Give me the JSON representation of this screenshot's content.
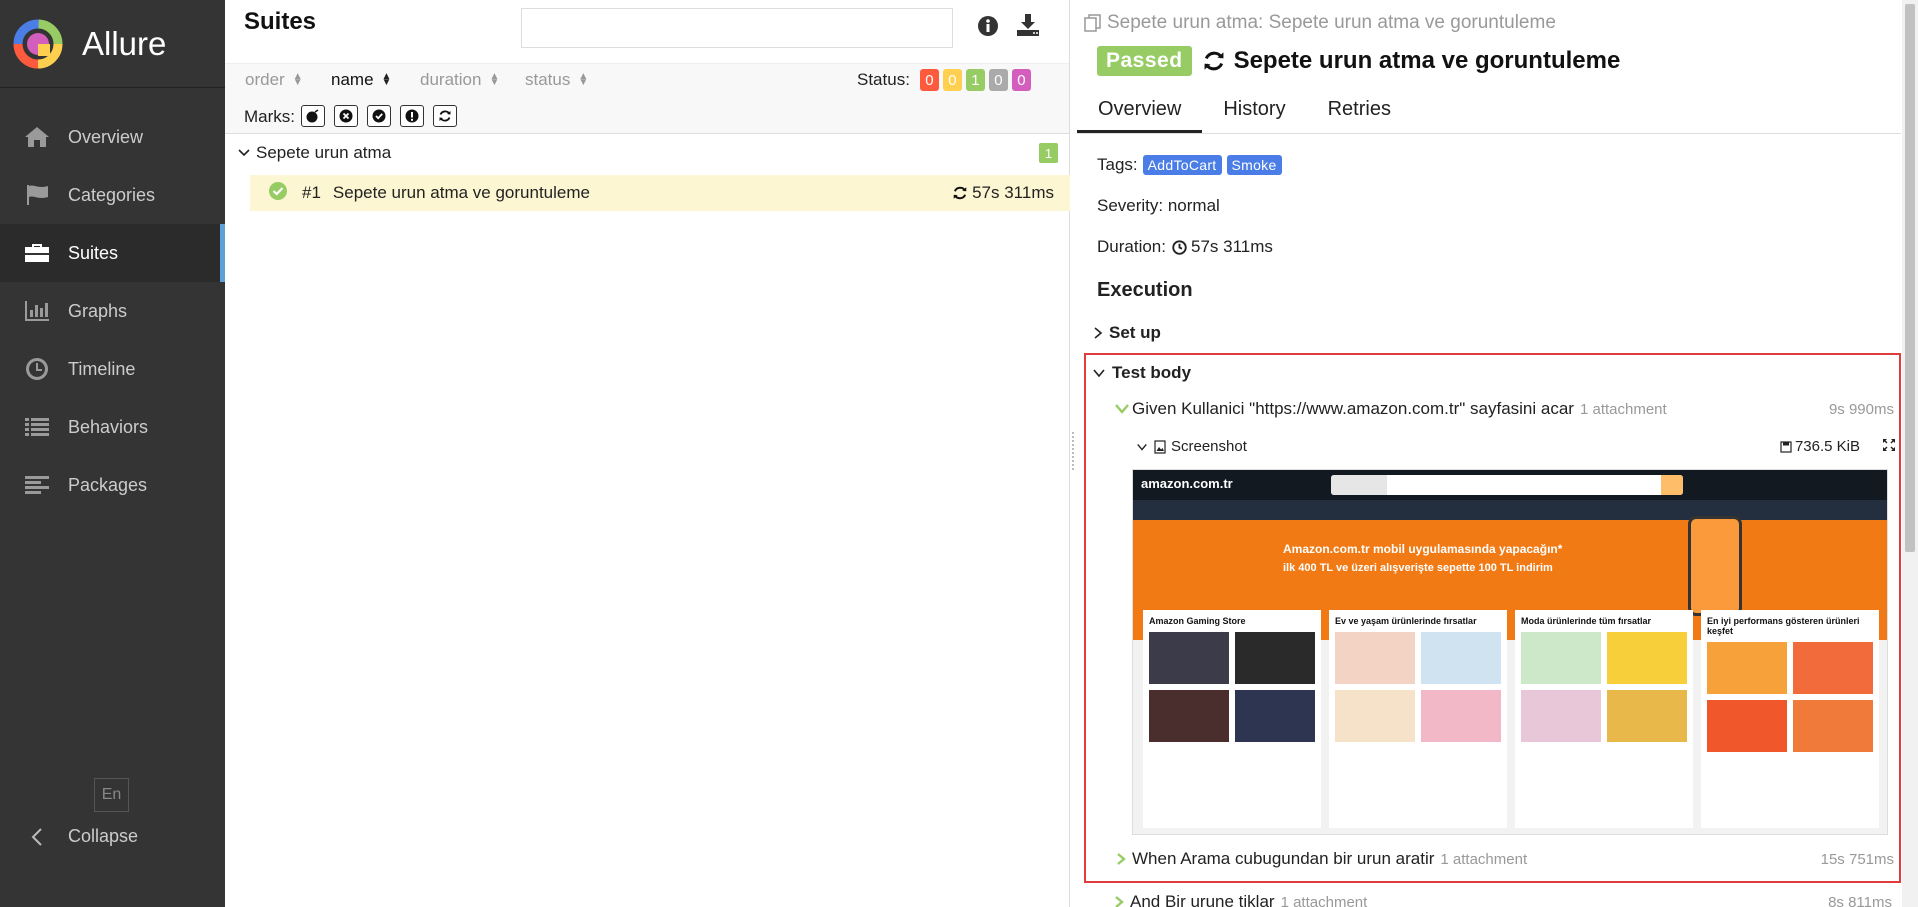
{
  "app": {
    "brand": "Allure"
  },
  "sidebar": {
    "items": [
      {
        "label": "Overview",
        "icon": "home-icon"
      },
      {
        "label": "Categories",
        "icon": "flag-icon"
      },
      {
        "label": "Suites",
        "icon": "briefcase-icon",
        "active": true
      },
      {
        "label": "Graphs",
        "icon": "bar-chart-icon"
      },
      {
        "label": "Timeline",
        "icon": "clock-icon"
      },
      {
        "label": "Behaviors",
        "icon": "list-icon"
      },
      {
        "label": "Packages",
        "icon": "align-left-icon"
      }
    ],
    "language": "En",
    "collapse_label": "Collapse"
  },
  "suites": {
    "title": "Suites",
    "search": {
      "value": "",
      "placeholder": ""
    },
    "sort": {
      "order": "order",
      "name": "name",
      "duration": "duration",
      "status": "status"
    },
    "status_label": "Status:",
    "status_counts": [
      {
        "value": "0",
        "color": "#fd5a3e"
      },
      {
        "value": "0",
        "color": "#ffd050"
      },
      {
        "value": "1",
        "color": "#97cc64"
      },
      {
        "value": "0",
        "color": "#aaaaaa"
      },
      {
        "value": "0",
        "color": "#d35ebe"
      }
    ],
    "marks_label": "Marks:",
    "group": {
      "name": "Sepete urun atma",
      "count": "1"
    },
    "test": {
      "number": "#1",
      "name": "Sepete urun atma ve goruntuleme",
      "duration": "57s 311ms"
    }
  },
  "detail": {
    "breadcrumb": "Sepete urun atma: Sepete urun atma ve goruntuleme",
    "status": "Passed",
    "title": "Sepete urun atma ve goruntuleme",
    "tabs": [
      "Overview",
      "History",
      "Retries"
    ],
    "tags_label": "Tags:",
    "tags": [
      "AddToCart",
      "Smoke"
    ],
    "severity": "Severity: normal",
    "duration_label": "Duration:",
    "duration": "57s 311ms",
    "execution_title": "Execution",
    "setup_label": "Set up",
    "test_body_label": "Test body",
    "steps": [
      {
        "name": "Given Kullanici \"https://www.amazon.com.tr\" sayfasini acar",
        "attachments": "1 attachment",
        "time": "9s 990ms"
      },
      {
        "name": "When Arama cubugundan bir urun aratir",
        "attachments": "1 attachment",
        "time": "15s 751ms"
      },
      {
        "name": "And Bir urune tiklar",
        "attachments": "1 attachment",
        "time": "8s 811ms"
      }
    ],
    "attachment": {
      "name": "Screenshot",
      "size": "736.5 KiB"
    },
    "screenshot": {
      "logo": "amazon.com.tr",
      "hero_line1": "Amazon.com.tr mobil uygulamasında yapacağın*",
      "hero_line2": "ilk 400 TL ve üzeri alışverişte sepette 100 TL indirim",
      "cards": [
        "Amazon Gaming Store",
        "Ev ve yaşam ürünlerinde fırsatlar",
        "Moda ürünlerinde tüm fırsatlar",
        "En iyi performans gösteren ürünleri keşfet"
      ]
    }
  }
}
